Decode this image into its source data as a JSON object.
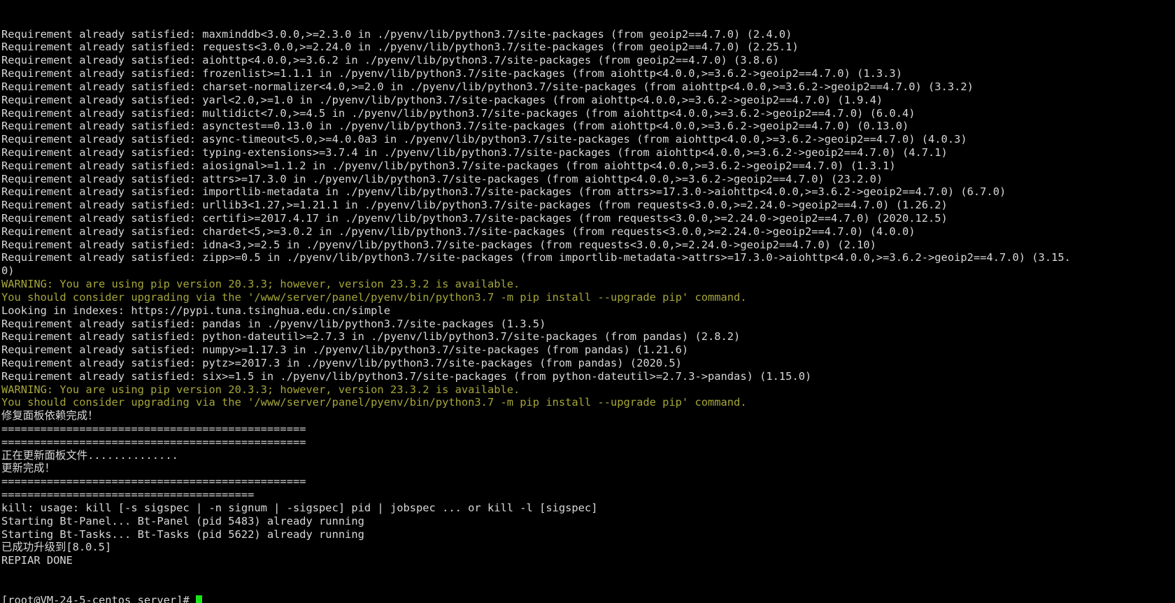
{
  "terminal": {
    "window_title": "root@VM-24-5-centos:/www/server",
    "background_color": "#000000",
    "foreground_color": "#d8d8d8",
    "warning_color": "#a6a63a",
    "cursor_color": "#19e619",
    "font_size_px": 15,
    "columns": 195,
    "rows": 45,
    "prompt": "[root@VM-24-5-centos server]#",
    "hostname": "VM-24-5-centos",
    "user": "root",
    "cwd": "server",
    "cursor_visible": true,
    "lines": [
      {
        "id": "l01",
        "color": "default",
        "text": "Requirement already satisfied: maxminddb<3.0.0,>=2.3.0 in ./pyenv/lib/python3.7/site-packages (from geoip2==4.7.0) (2.4.0)"
      },
      {
        "id": "l02",
        "color": "default",
        "text": "Requirement already satisfied: requests<3.0.0,>=2.24.0 in ./pyenv/lib/python3.7/site-packages (from geoip2==4.7.0) (2.25.1)"
      },
      {
        "id": "l03",
        "color": "default",
        "text": "Requirement already satisfied: aiohttp<4.0.0,>=3.6.2 in ./pyenv/lib/python3.7/site-packages (from geoip2==4.7.0) (3.8.6)"
      },
      {
        "id": "l04",
        "color": "default",
        "text": "Requirement already satisfied: frozenlist>=1.1.1 in ./pyenv/lib/python3.7/site-packages (from aiohttp<4.0.0,>=3.6.2->geoip2==4.7.0) (1.3.3)"
      },
      {
        "id": "l05",
        "color": "default",
        "text": "Requirement already satisfied: charset-normalizer<4.0,>=2.0 in ./pyenv/lib/python3.7/site-packages (from aiohttp<4.0.0,>=3.6.2->geoip2==4.7.0) (3.3.2)"
      },
      {
        "id": "l06",
        "color": "default",
        "text": "Requirement already satisfied: yarl<2.0,>=1.0 in ./pyenv/lib/python3.7/site-packages (from aiohttp<4.0.0,>=3.6.2->geoip2==4.7.0) (1.9.4)"
      },
      {
        "id": "l07",
        "color": "default",
        "text": "Requirement already satisfied: multidict<7.0,>=4.5 in ./pyenv/lib/python3.7/site-packages (from aiohttp<4.0.0,>=3.6.2->geoip2==4.7.0) (6.0.4)"
      },
      {
        "id": "l08",
        "color": "default",
        "text": "Requirement already satisfied: asynctest==0.13.0 in ./pyenv/lib/python3.7/site-packages (from aiohttp<4.0.0,>=3.6.2->geoip2==4.7.0) (0.13.0)"
      },
      {
        "id": "l09",
        "color": "default",
        "text": "Requirement already satisfied: async-timeout<5.0,>=4.0.0a3 in ./pyenv/lib/python3.7/site-packages (from aiohttp<4.0.0,>=3.6.2->geoip2==4.7.0) (4.0.3)"
      },
      {
        "id": "l10",
        "color": "default",
        "text": "Requirement already satisfied: typing-extensions>=3.7.4 in ./pyenv/lib/python3.7/site-packages (from aiohttp<4.0.0,>=3.6.2->geoip2==4.7.0) (4.7.1)"
      },
      {
        "id": "l11",
        "color": "default",
        "text": "Requirement already satisfied: aiosignal>=1.1.2 in ./pyenv/lib/python3.7/site-packages (from aiohttp<4.0.0,>=3.6.2->geoip2==4.7.0) (1.3.1)"
      },
      {
        "id": "l12",
        "color": "default",
        "text": "Requirement already satisfied: attrs>=17.3.0 in ./pyenv/lib/python3.7/site-packages (from aiohttp<4.0.0,>=3.6.2->geoip2==4.7.0) (23.2.0)"
      },
      {
        "id": "l13",
        "color": "default",
        "text": "Requirement already satisfied: importlib-metadata in ./pyenv/lib/python3.7/site-packages (from attrs>=17.3.0->aiohttp<4.0.0,>=3.6.2->geoip2==4.7.0) (6.7.0)"
      },
      {
        "id": "l14",
        "color": "default",
        "text": "Requirement already satisfied: urllib3<1.27,>=1.21.1 in ./pyenv/lib/python3.7/site-packages (from requests<3.0.0,>=2.24.0->geoip2==4.7.0) (1.26.2)"
      },
      {
        "id": "l15",
        "color": "default",
        "text": "Requirement already satisfied: certifi>=2017.4.17 in ./pyenv/lib/python3.7/site-packages (from requests<3.0.0,>=2.24.0->geoip2==4.7.0) (2020.12.5)"
      },
      {
        "id": "l16",
        "color": "default",
        "text": "Requirement already satisfied: chardet<5,>=3.0.2 in ./pyenv/lib/python3.7/site-packages (from requests<3.0.0,>=2.24.0->geoip2==4.7.0) (4.0.0)"
      },
      {
        "id": "l17",
        "color": "default",
        "text": "Requirement already satisfied: idna<3,>=2.5 in ./pyenv/lib/python3.7/site-packages (from requests<3.0.0,>=2.24.0->geoip2==4.7.0) (2.10)"
      },
      {
        "id": "l18",
        "color": "default",
        "text": "Requirement already satisfied: zipp>=0.5 in ./pyenv/lib/python3.7/site-packages (from importlib-metadata->attrs>=17.3.0->aiohttp<4.0.0,>=3.6.2->geoip2==4.7.0) (3.15."
      },
      {
        "id": "l19",
        "color": "default",
        "text": "0)"
      },
      {
        "id": "l20",
        "color": "warn",
        "text": "WARNING: You are using pip version 20.3.3; however, version 23.3.2 is available."
      },
      {
        "id": "l21",
        "color": "warn",
        "text": "You should consider upgrading via the '/www/server/panel/pyenv/bin/python3.7 -m pip install --upgrade pip' command."
      },
      {
        "id": "l22",
        "color": "default",
        "text": "Looking in indexes: https://pypi.tuna.tsinghua.edu.cn/simple"
      },
      {
        "id": "l23",
        "color": "default",
        "text": "Requirement already satisfied: pandas in ./pyenv/lib/python3.7/site-packages (1.3.5)"
      },
      {
        "id": "l24",
        "color": "default",
        "text": "Requirement already satisfied: python-dateutil>=2.7.3 in ./pyenv/lib/python3.7/site-packages (from pandas) (2.8.2)"
      },
      {
        "id": "l25",
        "color": "default",
        "text": "Requirement already satisfied: numpy>=1.17.3 in ./pyenv/lib/python3.7/site-packages (from pandas) (1.21.6)"
      },
      {
        "id": "l26",
        "color": "default",
        "text": "Requirement already satisfied: pytz>=2017.3 in ./pyenv/lib/python3.7/site-packages (from pandas) (2020.5)"
      },
      {
        "id": "l27",
        "color": "default",
        "text": "Requirement already satisfied: six>=1.5 in ./pyenv/lib/python3.7/site-packages (from python-dateutil>=2.7.3->pandas) (1.15.0)"
      },
      {
        "id": "l28",
        "color": "warn",
        "text": "WARNING: You are using pip version 20.3.3; however, version 23.3.2 is available."
      },
      {
        "id": "l29",
        "color": "warn",
        "text": "You should consider upgrading via the '/www/server/panel/pyenv/bin/python3.7 -m pip install --upgrade pip' command."
      },
      {
        "id": "l30",
        "color": "cjk",
        "text": "修复面板依赖完成！"
      },
      {
        "id": "l31",
        "color": "default",
        "text": "==============================================="
      },
      {
        "id": "l32",
        "color": "default",
        "text": "==============================================="
      },
      {
        "id": "l33",
        "color": "cjk",
        "text": "正在更新面板文件.............."
      },
      {
        "id": "l34",
        "color": "cjk",
        "text": "更新完成！"
      },
      {
        "id": "l35",
        "color": "default",
        "text": "==============================================="
      },
      {
        "id": "l36",
        "color": "default",
        "text": "======================================="
      },
      {
        "id": "l37",
        "color": "default",
        "text": "kill: usage: kill [-s sigspec | -n signum | -sigspec] pid | jobspec ... or kill -l [sigspec]"
      },
      {
        "id": "l38",
        "color": "default",
        "text": "Starting Bt-Panel... Bt-Panel (pid 5483) already running"
      },
      {
        "id": "l39",
        "color": "default",
        "text": "Starting Bt-Tasks... Bt-Tasks (pid 5622) already running"
      },
      {
        "id": "l40",
        "color": "cjk",
        "text": "已成功升级到[8.0.5]"
      },
      {
        "id": "l41",
        "color": "default",
        "text": "REPIAR DONE"
      }
    ],
    "version_upgraded_to": "8.0.5",
    "bt_panel_pid": "5483",
    "bt_tasks_pid": "5622",
    "pip_current_version": "20.3.3",
    "pip_available_version": "23.3.2",
    "pip_index_url": "https://pypi.tuna.tsinghua.edu.cn/simple"
  }
}
